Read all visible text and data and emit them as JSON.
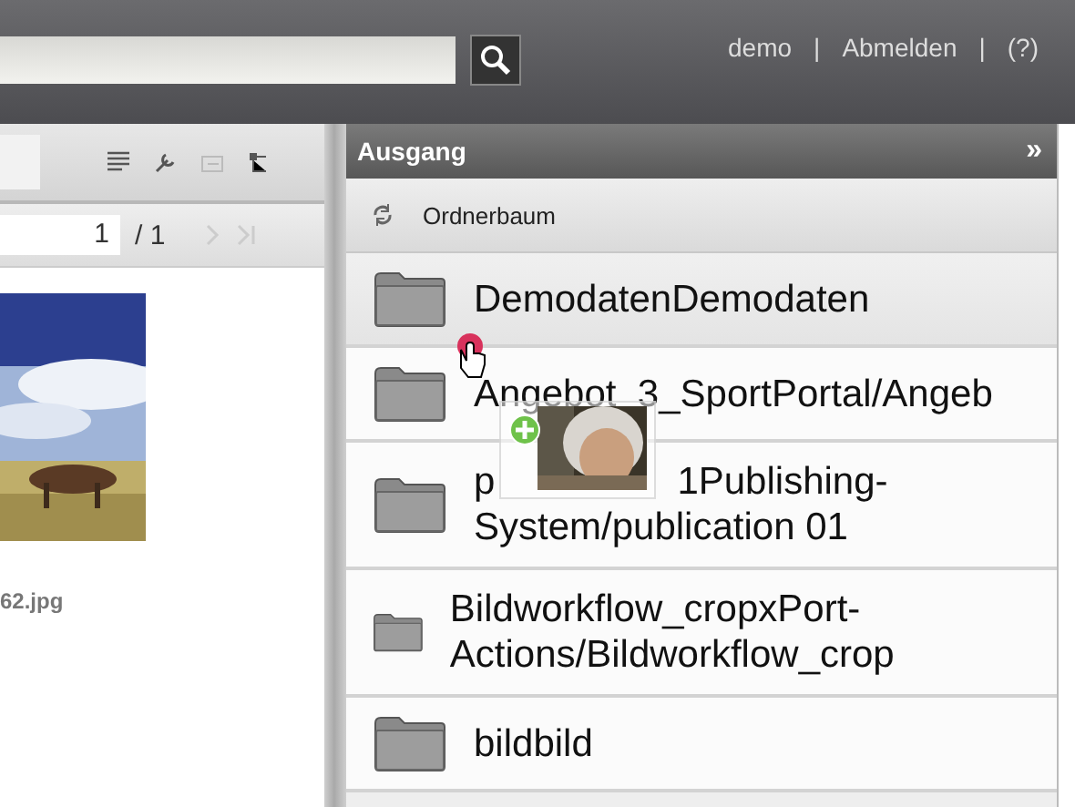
{
  "header": {
    "user_links": [
      {
        "label": "demo"
      },
      {
        "label": "Abmelden"
      },
      {
        "label": "(?)"
      }
    ],
    "separators": [
      "|",
      "|"
    ]
  },
  "left_panel": {
    "pager": {
      "page": "1",
      "total": "/ 1"
    },
    "thumbnail": {
      "kind": "picture",
      "filename": "62.jpg"
    }
  },
  "right_panel": {
    "title": "Ausgang",
    "collapse": "»",
    "toolbar_label": "Ordnerbaum",
    "folders": [
      {
        "name": "DemodatenDemodaten",
        "selected": true
      },
      {
        "name": "Angebot_3_SportPortal/Angeb",
        "selected": false
      },
      {
        "kind": "covered",
        "name_start": "p",
        "name_end": "1Publishing-",
        "name_line2": "System/publication 01",
        "selected": false
      },
      {
        "name": "Bildworkflow_cropxPort-Actions/Bildworkflow_crop",
        "selected": false
      },
      {
        "name": "bildbild",
        "selected": false
      }
    ]
  }
}
